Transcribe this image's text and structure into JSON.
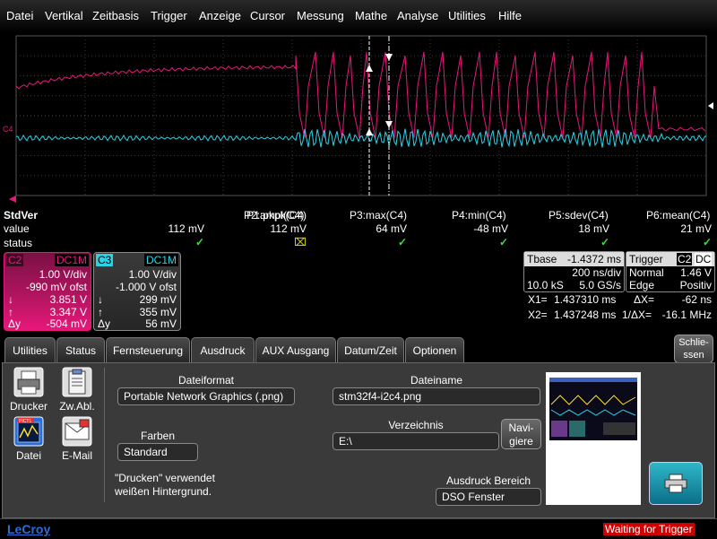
{
  "menu": [
    "Datei",
    "Vertikal",
    "Zeitbasis",
    "Trigger",
    "Anzeige",
    "Cursor",
    "Messung",
    "Mathe",
    "Analyse",
    "Utilities",
    "Hilfe"
  ],
  "grid": {
    "channel_label": "C4"
  },
  "measure": {
    "head": "StdVer",
    "row_value": "value",
    "row_status": "status",
    "params": [
      {
        "name": "P1:pkpk(C4)",
        "value": "112 mV",
        "status": "ok"
      },
      {
        "name": "P2:ampl(C4)",
        "value": "112 mV",
        "status": "warn"
      },
      {
        "name": "P3:max(C4)",
        "value": "64 mV",
        "status": "ok"
      },
      {
        "name": "P4:min(C4)",
        "value": "-48 mV",
        "status": "ok"
      },
      {
        "name": "P5:sdev(C4)",
        "value": "18 mV",
        "status": "ok"
      },
      {
        "name": "P6:mean(C4)",
        "value": "21 mV",
        "status": "ok"
      }
    ],
    "status_ok": "✓",
    "status_warn": "⌧"
  },
  "ch2": {
    "name": "C2",
    "coupling": "DC1M",
    "vdiv": "1.00 V/div",
    "ofst": "-990 mV ofst",
    "down_label": "↓",
    "down_val": "3.851 V",
    "up_label": "↑",
    "up_val": "3.347 V",
    "dy_label": "Δy",
    "dy_val": "-504 mV",
    "color": "#e8177a"
  },
  "ch3": {
    "name": "C3",
    "coupling": "DC1M",
    "vdiv": "1.00 V/div",
    "ofst": "-1.000 V ofst",
    "down_label": "↓",
    "down_val": "299 mV",
    "up_label": "↑",
    "up_val": "355 mV",
    "dy_label": "Δy",
    "dy_val": "56 mV",
    "color": "#29d3e6"
  },
  "tbase": {
    "label": "Tbase",
    "offset": "-1.4372 ms",
    "tdiv": "200 ns/div",
    "samples": "10.0 kS",
    "rate": "5.0 GS/s"
  },
  "trigger": {
    "label": "Trigger",
    "src": "C2",
    "coupling": "DC",
    "mode": "Normal",
    "level": "1.46 V",
    "type": "Edge",
    "slope": "Positiv"
  },
  "cursors": {
    "x1_label": "X1=",
    "x1": "1.437310 ms",
    "dx_label": "ΔX=",
    "dx": "-62 ns",
    "x2_label": "X2=",
    "x2": "1.437248 ms",
    "inv_label": "1/ΔX=",
    "inv": "-16.1 MHz"
  },
  "tabs": [
    "Utilities",
    "Status",
    "Fernsteuerung",
    "Ausdruck",
    "AUX Ausgang",
    "Datum/Zeit",
    "Optionen"
  ],
  "active_tab": "Ausdruck",
  "close_label_1": "Schlie-",
  "close_label_2": "ssen",
  "left_icons": [
    {
      "label": "Drucker",
      "name": "printer"
    },
    {
      "label": "Zw.Abl.",
      "name": "clipboard"
    },
    {
      "label": "Datei",
      "name": "file"
    },
    {
      "label": "E-Mail",
      "name": "email"
    }
  ],
  "file_icon_text": "PICT1",
  "form": {
    "format_label": "Dateiformat",
    "format_value": "Portable Network Graphics (.png)",
    "colors_label": "Farben",
    "colors_value": "Standard",
    "note_1": "\"Drucken\" verwendet",
    "note_2": "weißen Hintergrund.",
    "filename_label": "Dateiname",
    "filename_value": "stm32f4-i2c4.png",
    "dir_label": "Verzeichnis",
    "dir_value": "E:\\",
    "browse_1": "Navi-",
    "browse_2": "giere",
    "area_label": "Ausdruck Bereich",
    "area_value": "DSO Fenster"
  },
  "status_bar": {
    "brand": "LeCroy",
    "message": "Waiting for Trigger"
  },
  "colors": {
    "c4": "#e8177a",
    "c3": "#29d3e6",
    "grid": "#555",
    "accent": "#2a6fd6"
  }
}
